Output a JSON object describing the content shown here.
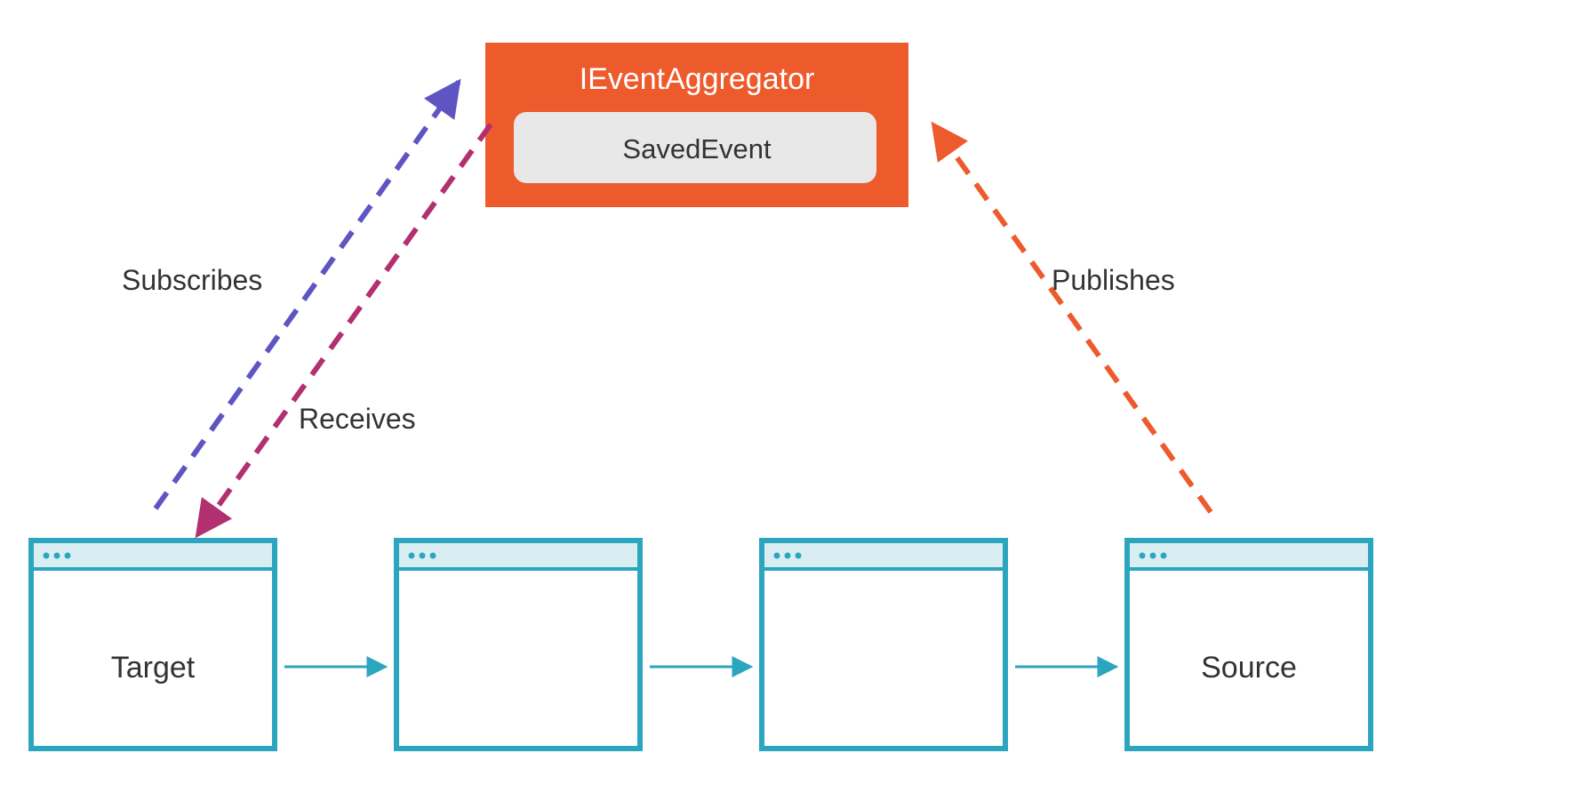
{
  "aggregator": {
    "title": "IEventAggregator",
    "event": "SavedEvent"
  },
  "windows": [
    {
      "label": "Target"
    },
    {
      "label": ""
    },
    {
      "label": ""
    },
    {
      "label": "Source"
    }
  ],
  "edges": {
    "subscribes": "Subscribes",
    "receives": "Receives",
    "publishes": "Publishes"
  },
  "colors": {
    "orange": "#ED5B2D",
    "teal": "#2CA5BF",
    "tealLight": "#D9EEF3",
    "purple": "#5E55C2",
    "magenta": "#B33070",
    "gray": "#E8E8E8",
    "text": "#333333"
  }
}
